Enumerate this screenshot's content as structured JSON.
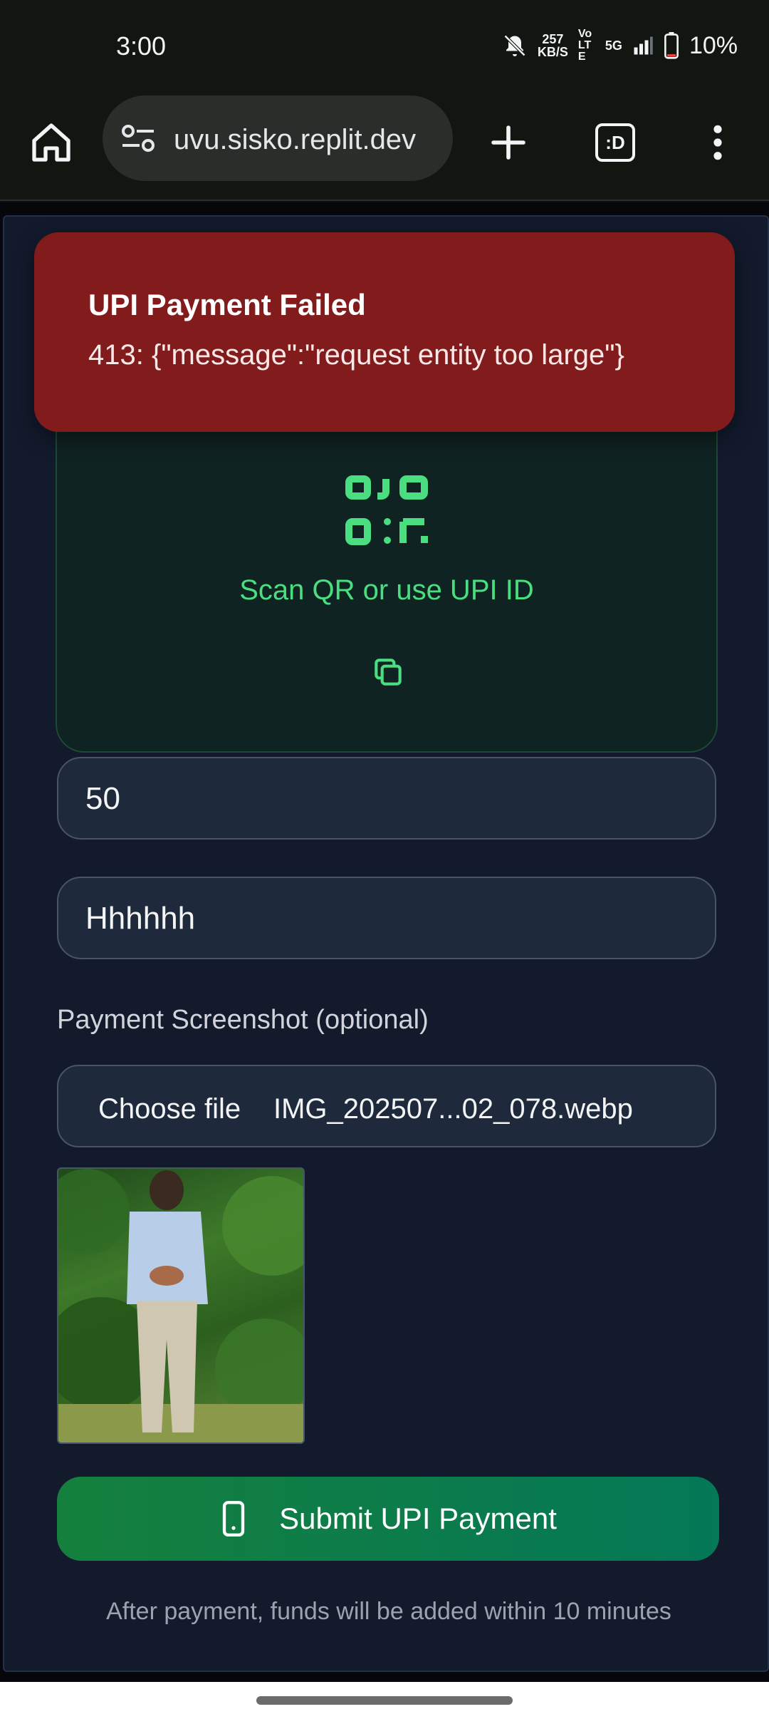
{
  "status_bar": {
    "time": "3:00",
    "speed_value": "257",
    "speed_unit": "KB/S",
    "volte": "Vo LTE",
    "network": "5G",
    "battery": "10%",
    "icons": [
      "bell-off-icon",
      "signal-icon",
      "battery-icon"
    ]
  },
  "browser": {
    "url": "uvu.sisko.replit.dev",
    "tab_label": ":D",
    "icons": [
      "home-icon",
      "site-settings-icon",
      "new-tab-icon",
      "tabs-icon",
      "menu-icon"
    ]
  },
  "qr_section": {
    "caption": "Scan QR or use UPI ID",
    "accent_color": "#4ade80"
  },
  "form": {
    "amount_value": "50",
    "reference_value": "Hhhhhh",
    "screenshot_label": "Payment Screenshot (optional)",
    "choose_file_label": "Choose file",
    "file_name": "IMG_202507...02_078.webp",
    "submit_label": "Submit UPI Payment",
    "footnote": "After payment, funds will be added within 10 minutes"
  },
  "toast": {
    "title": "UPI Payment Failed",
    "message": "413: {\"message\":\"request entity too large\"}",
    "color": "#821c1c"
  }
}
